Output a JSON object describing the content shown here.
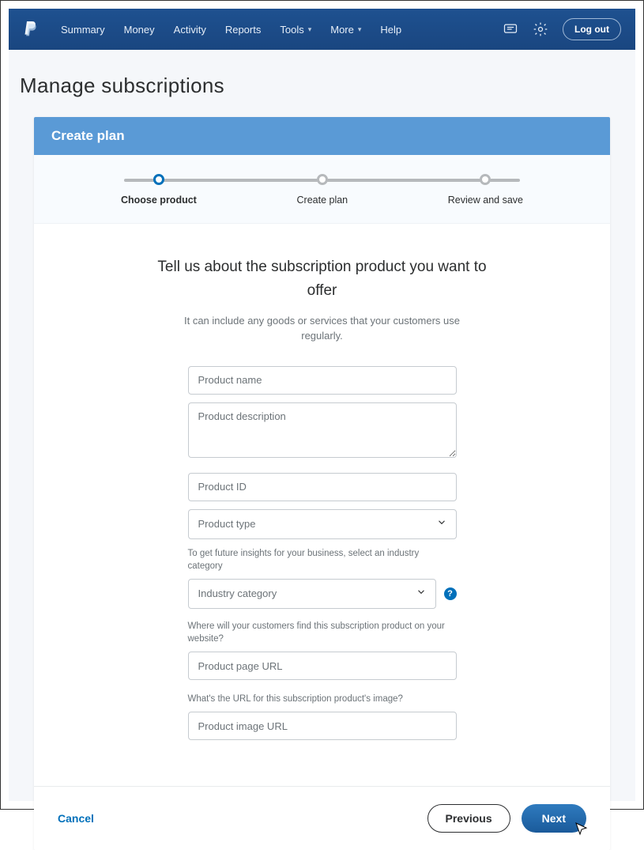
{
  "nav": {
    "items": [
      "Summary",
      "Money",
      "Activity",
      "Reports",
      "Tools",
      "More",
      "Help"
    ],
    "logout": "Log out"
  },
  "page_title": "Manage subscriptions",
  "card_header": "Create plan",
  "steps": [
    {
      "label": "Choose product",
      "active": true
    },
    {
      "label": "Create plan",
      "active": false
    },
    {
      "label": "Review and save",
      "active": false
    }
  ],
  "form": {
    "heading": "Tell us about the subscription product you want to offer",
    "sub": "It can include any goods or services that your customers use regularly.",
    "product_name_ph": "Product name",
    "product_desc_ph": "Product description",
    "product_id_ph": "Product ID",
    "product_type_ph": "Product type",
    "industry_helper": "To get future insights for your business, select an industry category",
    "industry_ph": "Industry category",
    "help_dot": "?",
    "page_url_helper": "Where will your customers find this subscription product on your website?",
    "page_url_ph": "Product page URL",
    "image_url_helper": "What's the URL for this subscription product's image?",
    "image_url_ph": "Product image URL"
  },
  "footer": {
    "cancel": "Cancel",
    "previous": "Previous",
    "next": "Next"
  }
}
